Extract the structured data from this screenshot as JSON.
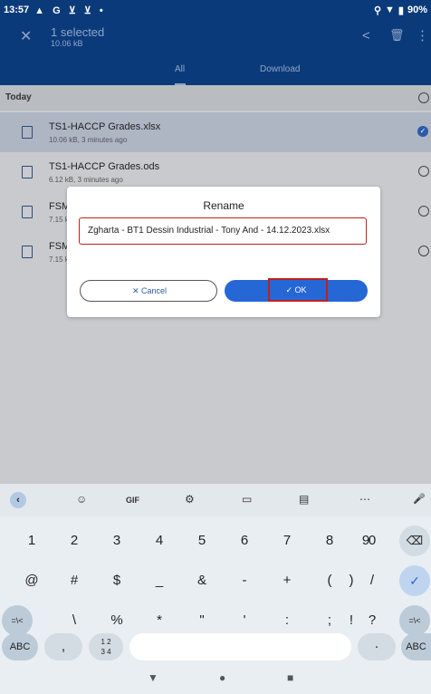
{
  "status": {
    "time": "13:57",
    "left_icons": "▲ G ⊻ ⊻ •",
    "battery": "90%"
  },
  "appbar": {
    "title": "1 selected",
    "subtitle": "10.06 kB"
  },
  "tabs": [
    "All",
    "Download"
  ],
  "section": "Today",
  "files": [
    {
      "name": "TS1-HACCP Grades.xlsx",
      "meta": "10.06 kB, 3 minutes ago",
      "selected": true
    },
    {
      "name": "TS1-HACCP Grades.ods",
      "meta": "6.12 kB, 3 minutes ago",
      "selected": false
    },
    {
      "name": "FSM",
      "meta": "7.15 k",
      "selected": false
    },
    {
      "name": "FSM",
      "meta": "7.15 k",
      "selected": false
    }
  ],
  "dialog": {
    "title": "Rename",
    "filename": "Zgharta - BT1 Dessin Industrial - Tony And - 14.12.2023.xlsx",
    "cancel_label": "✕  Cancel",
    "ok_label": "✓  OK"
  },
  "keyboard": {
    "toolbar": [
      "☺",
      "GIF",
      "⚙",
      "▭",
      "▤",
      "⋯",
      "🎤"
    ],
    "row1": [
      "1",
      "2",
      "3",
      "4",
      "5",
      "6",
      "7",
      "8",
      "9",
      "0"
    ],
    "row2": [
      "@",
      "#",
      "$",
      "_",
      "&",
      "-",
      "+",
      "(",
      ")",
      "/"
    ],
    "row3": [
      "\\",
      "%",
      "*",
      "\"",
      "'",
      ":",
      ";",
      "!",
      "?"
    ],
    "shift_left": "=\\<",
    "shift_right": "=\\<",
    "abc": "ABC",
    "comma": ",",
    "fraction": "1 2\n3 4",
    "period": "·"
  },
  "colors": {
    "appbar": "#0b3a7a",
    "accent": "#2667d6",
    "highlight": "#c0201c"
  }
}
